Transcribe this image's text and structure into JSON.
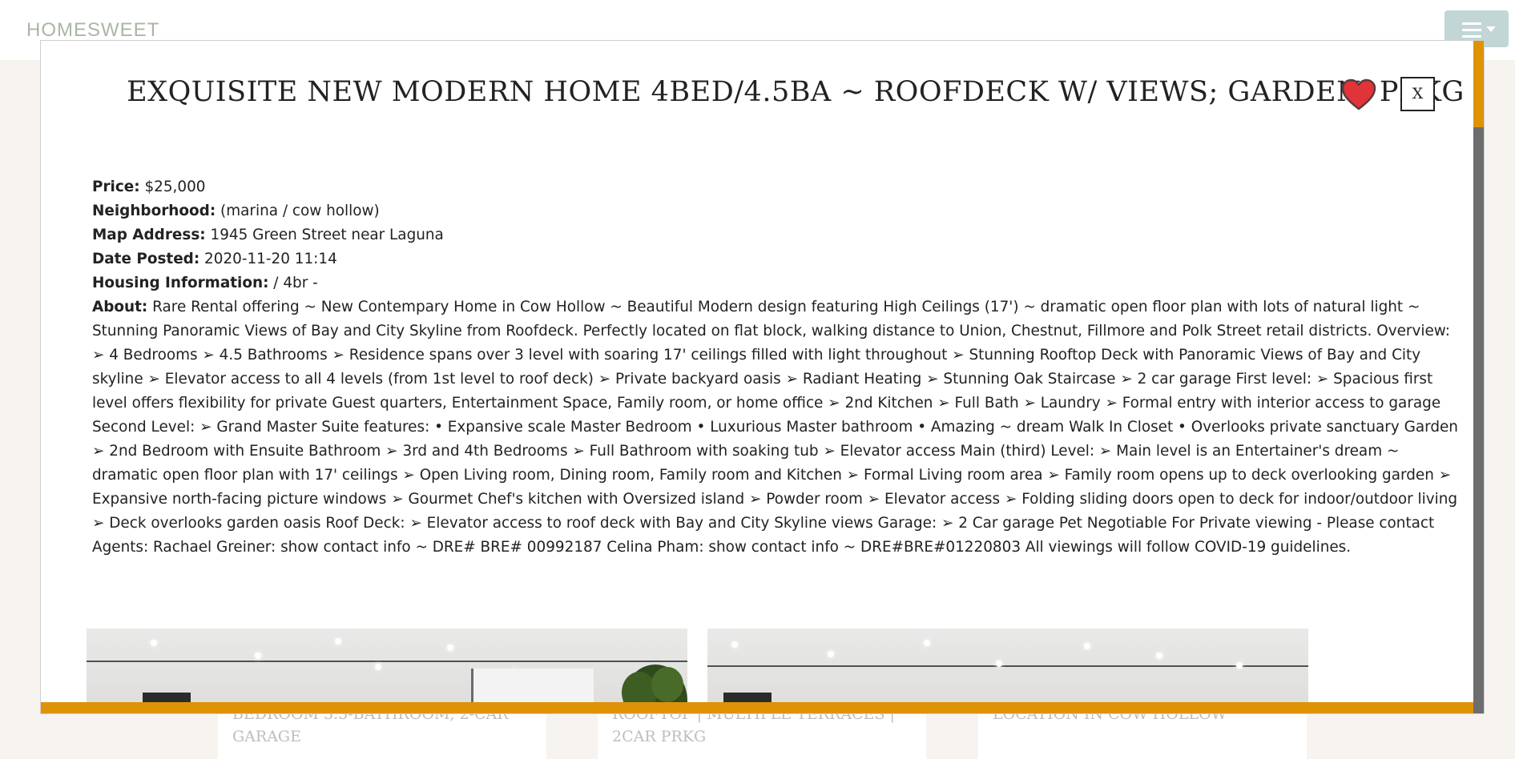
{
  "nav": {
    "brand": "HOMESWEET"
  },
  "background_cards": [
    {
      "text": "BEDROOM 3.5-BATHROOM, 2-CAR GARAGE"
    },
    {
      "text": "ROOFTOP | MULTIPLE TERRACES | 2CAR PRKG"
    },
    {
      "text": "LOCATION IN COW HOLLOW"
    }
  ],
  "modal": {
    "title": "EXQUISITE NEW MODERN HOME 4BED/4.5BA ~ ROOFDECK W/ VIEWS; GARDEN; PRKG",
    "close_label": "X",
    "favorite_icon": "heart-icon",
    "favorite_color": "#e0333a",
    "details": {
      "price_label": "Price:",
      "price": "$25,000",
      "neighborhood_label": "Neighborhood:",
      "neighborhood": "(marina / cow hollow)",
      "address_label": "Map Address:",
      "address": "1945 Green Street near Laguna",
      "date_label": "Date Posted:",
      "date": "2020-11-20 11:14",
      "housing_label": "Housing Information:",
      "housing": "/ 4br -",
      "about_label": "About:",
      "about": "Rare Rental offering ~ New Contempary Home in Cow Hollow ~ Beautiful Modern design featuring High Ceilings (17') ~ dramatic open floor plan with lots of natural light ~ Stunning Panoramic Views of Bay and City Skyline from Roofdeck. Perfectly located on flat block, walking distance to Union, Chestnut, Fillmore and Polk Street retail districts. Overview: ➢ 4 Bedrooms ➢ 4.5 Bathrooms ➢ Residence spans over 3 level with soaring 17' ceilings filled with light throughout ➢ Stunning Rooftop Deck with Panoramic Views of Bay and City skyline ➢ Elevator access to all 4 levels (from 1st level to roof deck) ➢ Private backyard oasis ➢ Radiant Heating ➢ Stunning Oak Staircase ➢ 2 car garage First level: ➢ Spacious first level offers flexibility for private Guest quarters, Entertainment Space, Family room, or home office ➢ 2nd Kitchen ➢ Full Bath ➢ Laundry ➢ Formal entry with interior access to garage Second Level: ➢ Grand Master Suite features: • Expansive scale Master Bedroom • Luxurious Master bathroom • Amazing ~ dream Walk In Closet • Overlooks private sanctuary Garden ➢ 2nd Bedroom with Ensuite Bathroom ➢ 3rd and 4th Bedrooms ➢ Full Bathroom with soaking tub ➢ Elevator access Main (third) Level: ➢ Main level is an Entertainer's dream ~ dramatic open floor plan with 17' ceilings ➢ Open Living room, Dining room, Family room and Kitchen ➢ Formal Living room area ➢ Family room opens up to deck overlooking garden ➢ Expansive north-facing picture windows ➢ Gourmet Chef's kitchen with Oversized island ➢ Powder room ➢ Elevator access ➢ Folding sliding doors open to deck for indoor/outdoor living ➢ Deck overlooks garden oasis Roof Deck: ➢ Elevator access to roof deck with Bay and City Skyline views Garage: ➢ 2 Car garage Pet Negotiable For Private viewing - Please contact Agents: Rachael Greiner: show contact info ~ DRE# BRE# 00992187 Celina Pham: show contact info ~ DRE#BRE#01220803 All viewings will follow COVID-19 guidelines."
    }
  },
  "colors": {
    "scroll_accent": "#de9307",
    "scroll_track": "#6d6d6d"
  }
}
